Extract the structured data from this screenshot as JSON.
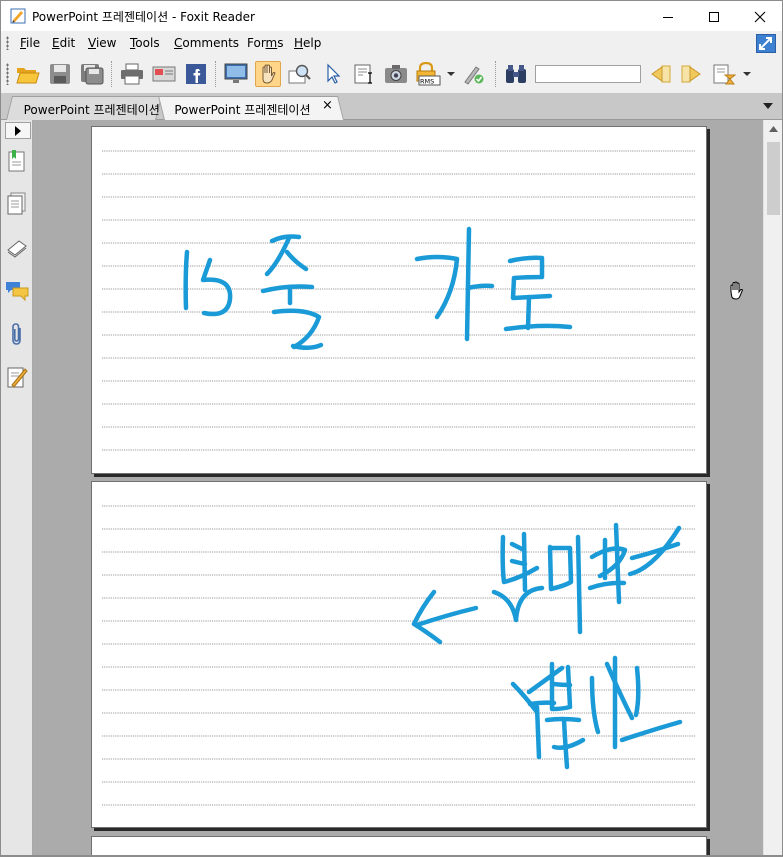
{
  "window": {
    "title": "PowerPoint 프레젠테이션 - Foxit Reader"
  },
  "menu": {
    "items": [
      {
        "label": "File",
        "key": "F",
        "rest": "ile"
      },
      {
        "label": "Edit",
        "key": "E",
        "rest": "dit"
      },
      {
        "label": "View",
        "key": "V",
        "rest": "iew"
      },
      {
        "label": "Tools",
        "key": "T",
        "rest": "ools"
      },
      {
        "label": "Comments",
        "key": "C",
        "rest": "omments"
      },
      {
        "label": "Forms",
        "key": "",
        "pre": "For",
        "key2": "m",
        "post": "s"
      },
      {
        "label": "Help",
        "key": "H",
        "rest": "elp"
      }
    ]
  },
  "toolbar": {
    "icons": [
      "open-folder-icon",
      "save-icon",
      "save-as-icon",
      "print-icon",
      "email-icon",
      "facebook-icon",
      "fullscreen-icon",
      "hand-tool-icon",
      "zoom-icon",
      "select-arrow-icon",
      "text-select-icon",
      "snapshot-icon",
      "rms-lock-icon",
      "sign-icon",
      "find-binoculars-icon",
      "find-prev-icon",
      "find-next-icon",
      "find-options-icon"
    ],
    "find_value": "",
    "accent_active": "#ffd58a"
  },
  "tabs": [
    {
      "label": "PowerPoint 프레젠테이션",
      "active": false
    },
    {
      "label": "PowerPoint 프레젠테이션",
      "active": true
    }
  ],
  "tab_close_glyph": "×",
  "left_panel": {
    "icons": [
      "bookmarks-icon",
      "pages-icon",
      "layers-icon",
      "comments-icon",
      "attachments-icon",
      "signatures-icon"
    ]
  },
  "document": {
    "pages": [
      {
        "handwriting": "15줄 가로"
      },
      {
        "handwriting": "← 여백없는 부분선"
      }
    ],
    "ink_color": "#1a9ad6",
    "rule_color": "#9a9a9a"
  }
}
